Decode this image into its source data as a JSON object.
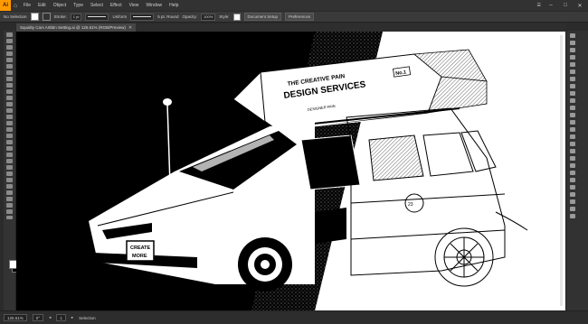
{
  "menubar": {
    "app_logo": "Ai",
    "home_icon": "home-icon",
    "items": [
      "File",
      "Edit",
      "Object",
      "Type",
      "Select",
      "Effect",
      "View",
      "Window",
      "Help"
    ],
    "workspace": "☰",
    "window_buttons": [
      "–",
      "□",
      "✕"
    ]
  },
  "control_bar": {
    "selection_label": "No Selection",
    "stroke_label": "Stroke:",
    "stroke_weight": "1 pt",
    "uniform_label": "Uniform",
    "brush_label": "5 pt. Round",
    "opacity_label": "Opacity:",
    "opacity_value": "100%",
    "style_label": "Style:",
    "document_setup": "Document Setup",
    "preferences": "Preferences"
  },
  "document_tab": {
    "title": "Squality Cars Artbtin Setting.ai @ 125.61% (RGB/Preview)",
    "close": "✕"
  },
  "artwork": {
    "banner_line1": "THE CREATIVE PAIN",
    "banner_line2": "DESIGN SERVICES",
    "banner_badge": "No.1",
    "banner_small": "DESIGNER PAIN",
    "plate_line1": "CREATE",
    "plate_line2": "MORE"
  },
  "statusbar": {
    "zoom": "125.61%",
    "angle": "0°",
    "artboard": "1",
    "tool": "Selection"
  },
  "colors": {
    "app_bg": "#2b2b2b",
    "accent": "#ff9a00",
    "canvas_dark": "#000000",
    "canvas_light": "#ffffff"
  }
}
